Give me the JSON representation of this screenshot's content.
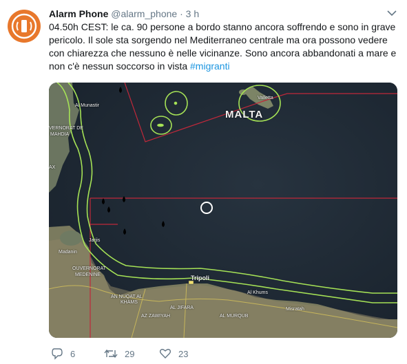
{
  "tweet": {
    "author_name": "Alarm Phone",
    "author_handle": "@alarm_phone",
    "separator": "·",
    "time": "3 h",
    "text_lines": [
      "04.50h CEST: le ca. 90 persone a bordo stanno ancora soffrendo e sono in grave",
      "pericolo. Il sole sta sorgendo nel Mediterraneo centrale ma ora possono vedere",
      "con chiarezza che nessuno è nelle vicinanze. Sono ancora abbandonati a mare e"
    ],
    "text_line4": "non c'è  nessun soccorso in vista ",
    "hashtag": "#migranti",
    "colors": {
      "accent": "#1b95e0",
      "avatar": "#e8782c",
      "map_lines": "#a6e356",
      "sar_border": "#c0283a"
    }
  },
  "map": {
    "labels": {
      "malta": "MALTA",
      "valletta": "Valletta",
      "monastir": "Al Munastir",
      "gouvernorat": "VERNORAT DE",
      "mahdia": "MAHDIA",
      "ax": "AX",
      "jarjis": "Jarjis",
      "madanin": "Madanin",
      "gouvernorat2": "OUVERNORAT",
      "medenine": "MEDENINE",
      "tripoli": "Tripoli",
      "al_khums": "Al Khums",
      "misratah": "Misratah",
      "an_nuqat": "AN NUQAT AL",
      "khams": "KHAMS",
      "al_jifara": "AL JIFARA",
      "az_zawiyah": "AZ ZAWIYAH",
      "al_murqub": "AL MURQUB"
    }
  },
  "actions": {
    "replies": "6",
    "retweets": "29",
    "likes": "23"
  }
}
